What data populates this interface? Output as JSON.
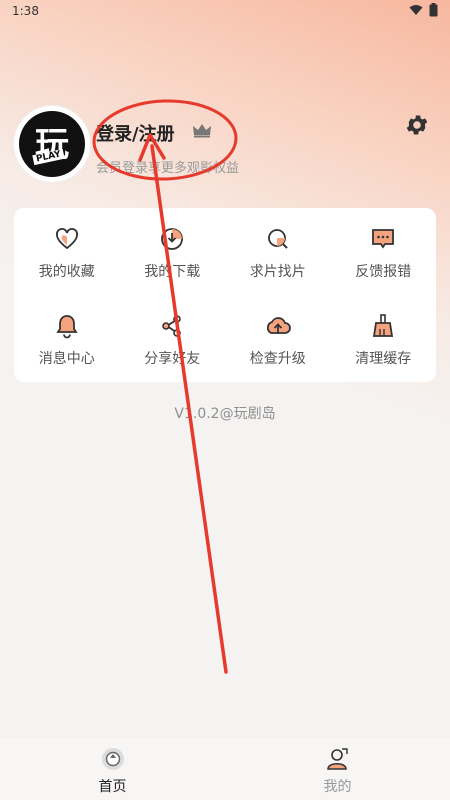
{
  "status_bar": {
    "time": "1:38"
  },
  "profile": {
    "avatar_char": "玩",
    "avatar_tag": "PLAY",
    "login_title": "登录/注册",
    "login_subtitle": "会员登录享更多观影权益"
  },
  "menu": {
    "items": [
      {
        "label": "我的收藏",
        "icon": "heart-icon"
      },
      {
        "label": "我的下载",
        "icon": "download-icon"
      },
      {
        "label": "求片找片",
        "icon": "search-icon"
      },
      {
        "label": "反馈报错",
        "icon": "feedback-icon"
      },
      {
        "label": "消息中心",
        "icon": "bell-icon"
      },
      {
        "label": "分享好友",
        "icon": "share-icon"
      },
      {
        "label": "检查升级",
        "icon": "upgrade-icon"
      },
      {
        "label": "清理缓存",
        "icon": "broom-icon"
      }
    ]
  },
  "version": "V1.0.2@玩剧岛",
  "bottom_nav": {
    "tabs": [
      {
        "label": "首页",
        "icon": "home-icon",
        "active": true
      },
      {
        "label": "我的",
        "icon": "profile-icon",
        "active": false
      }
    ]
  },
  "colors": {
    "accent": "#f4a37e",
    "annotation_red": "#e53a2c"
  }
}
